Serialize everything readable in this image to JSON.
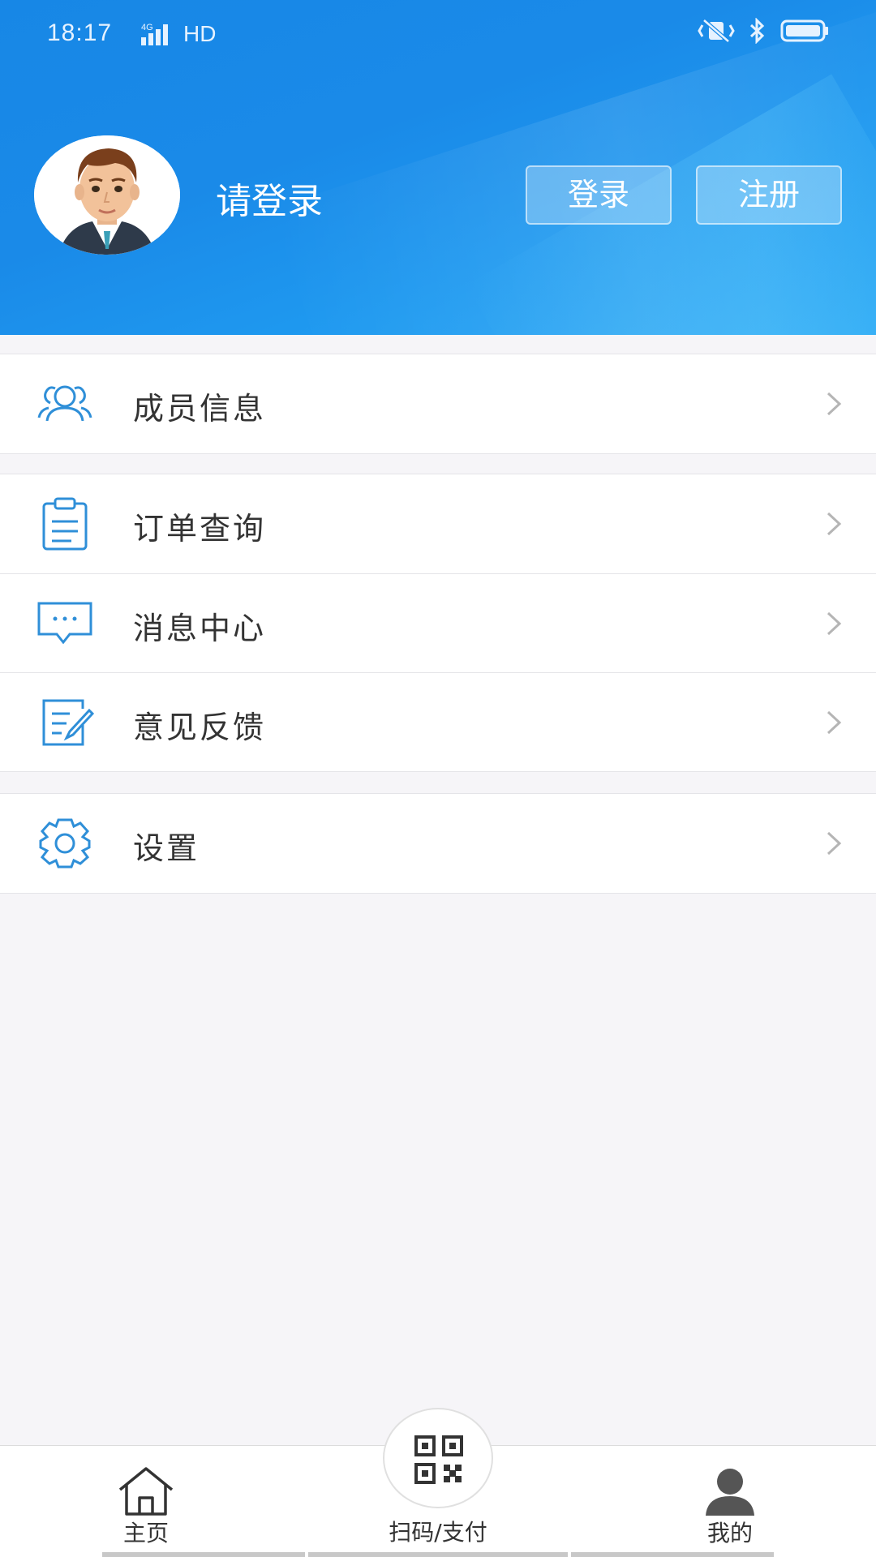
{
  "status_bar": {
    "time": "18:17",
    "network": "HD"
  },
  "profile": {
    "prompt": "请登录",
    "login_button": "登录",
    "register_button": "注册"
  },
  "menu": {
    "members": "成员信息",
    "orders": "订单查询",
    "messages": "消息中心",
    "feedback": "意见反馈",
    "settings": "设置"
  },
  "tabbar": {
    "home": "主页",
    "scan": "扫码/支付",
    "mine": "我的"
  },
  "colors": {
    "accent": "#1a8ae8",
    "icon": "#2f8fd8"
  }
}
